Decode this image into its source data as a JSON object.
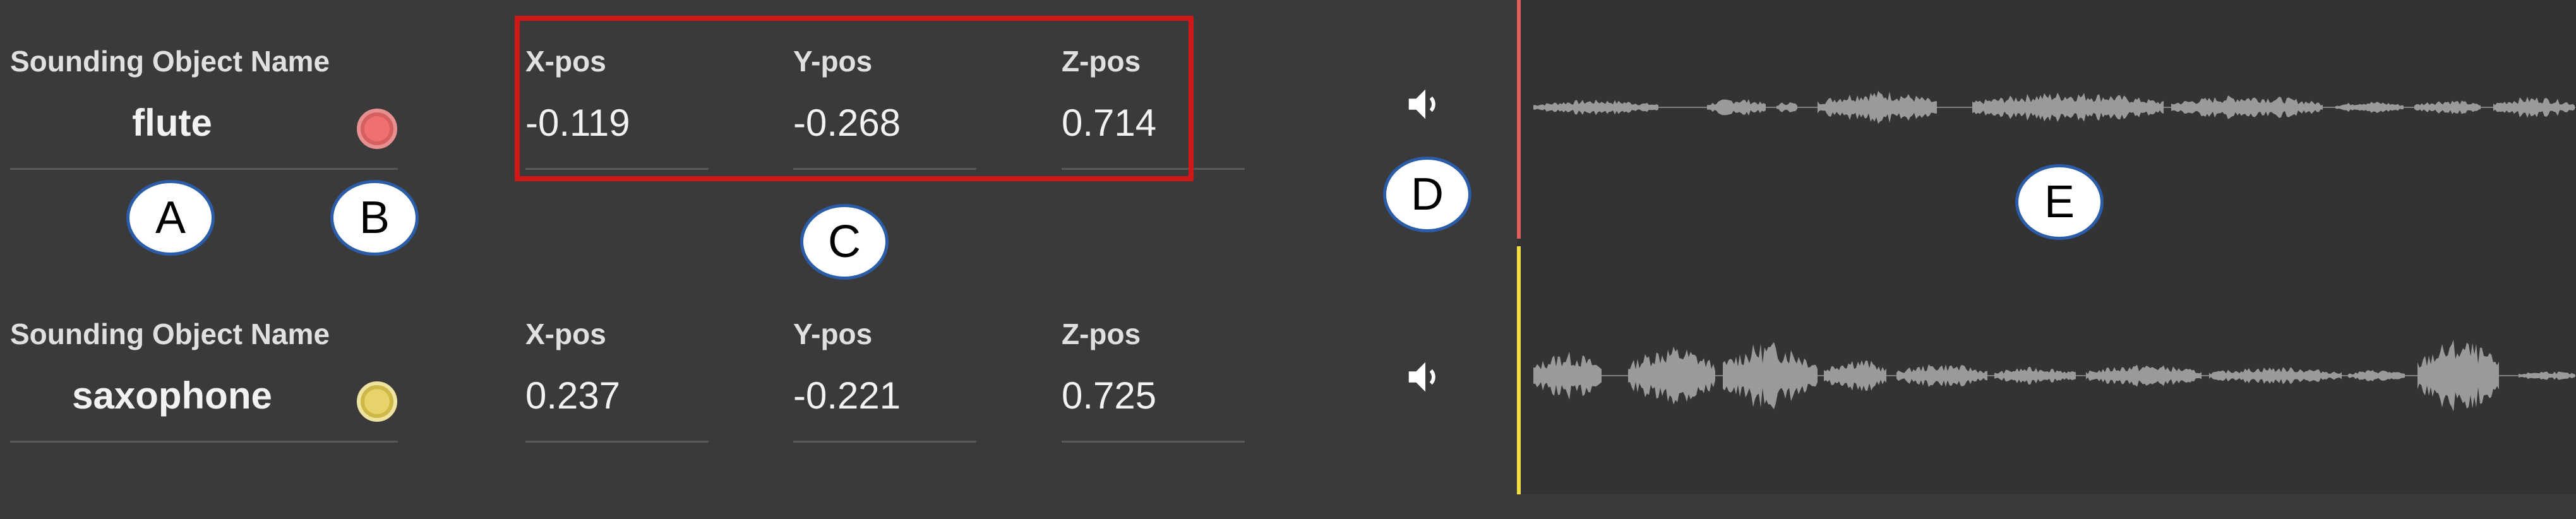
{
  "rows": [
    {
      "name_label": "Sounding Object Name",
      "name": "flute",
      "color": "#f06a6a",
      "x_label": "X-pos",
      "x": "-0.119",
      "y_label": "Y-pos",
      "y": "-0.268",
      "z_label": "Z-pos",
      "z": "0.714",
      "cursor_color": "#e06060"
    },
    {
      "name_label": "Sounding Object Name",
      "name": "saxophone",
      "color": "#e8d36a",
      "x_label": "X-pos",
      "x": "0.237",
      "y_label": "Y-pos",
      "y": "-0.221",
      "z_label": "Z-pos",
      "z": "0.725",
      "cursor_color": "#f0dd40"
    }
  ],
  "callouts": {
    "a": "A",
    "b": "B",
    "c": "C",
    "d": "D",
    "e": "E"
  },
  "icons": {
    "speaker": "volume-icon"
  },
  "colors": {
    "panel_bg": "#3a3a3a",
    "wave_bg": "#333333",
    "waveform": "#9a9a9a",
    "highlight": "#d01818",
    "callout_border": "#2b5ca8"
  }
}
